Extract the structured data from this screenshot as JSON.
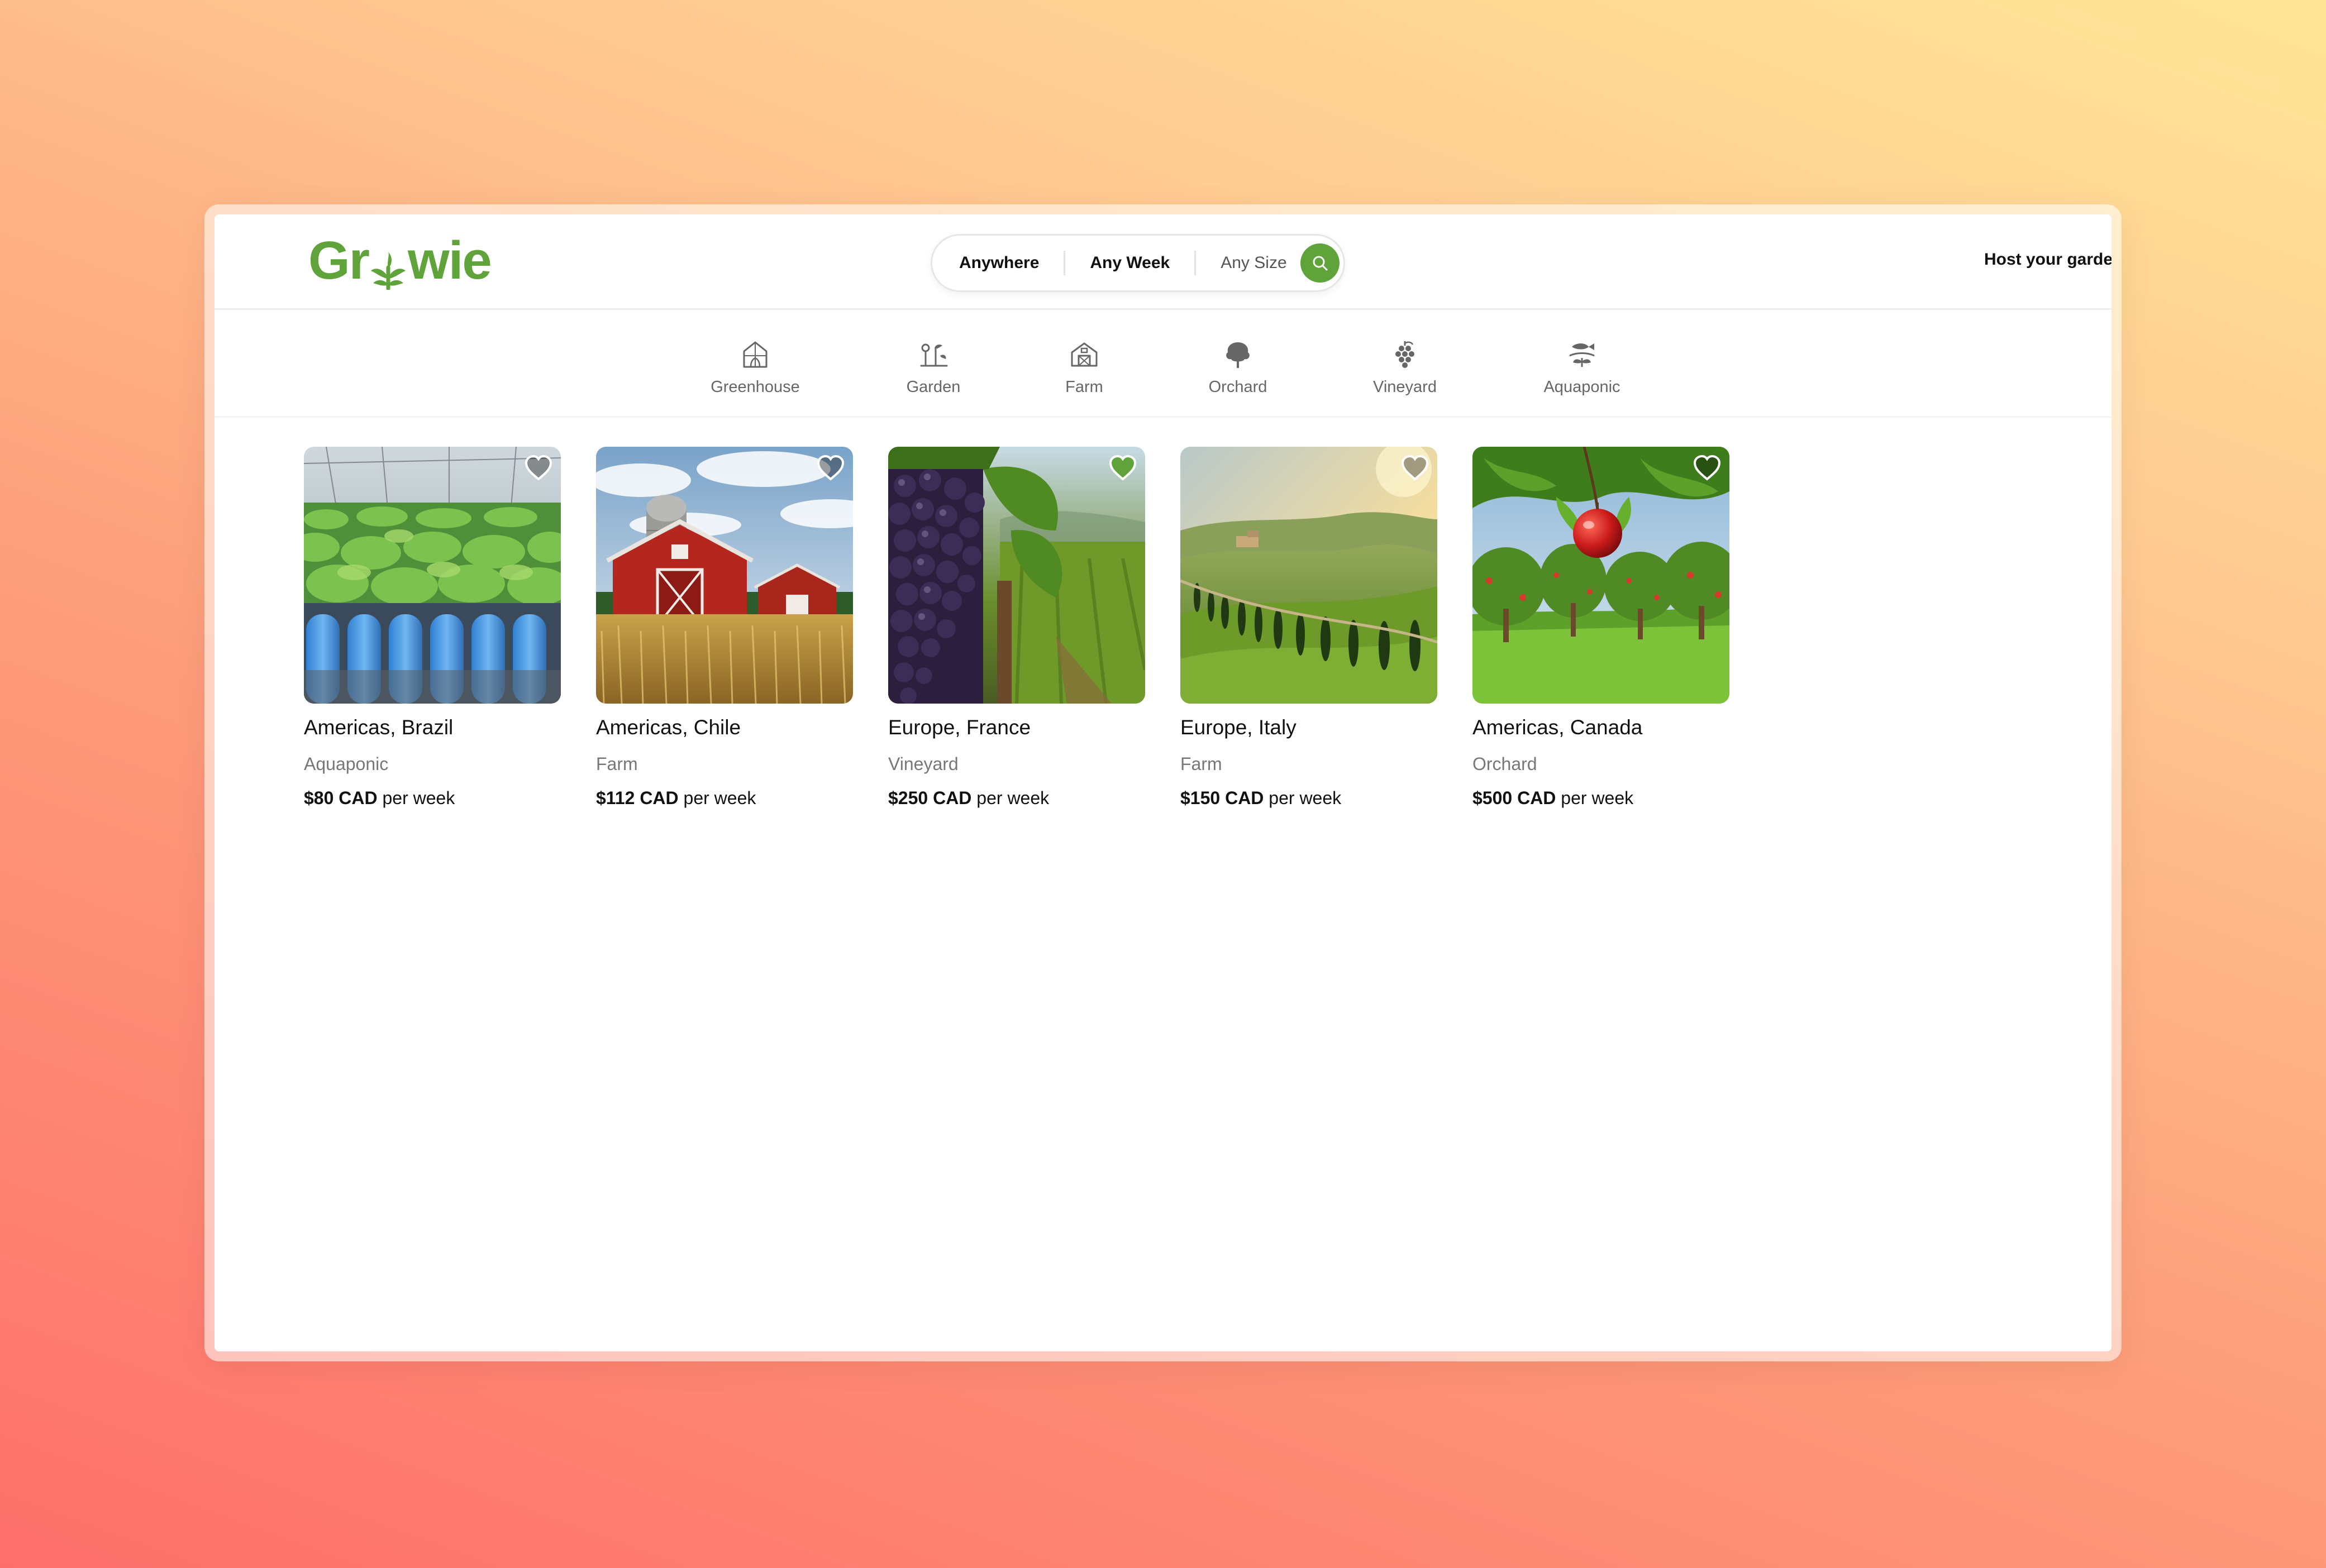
{
  "brand": {
    "logo_left": "Gr",
    "logo_right": "wie",
    "accent": "#5fa33a"
  },
  "search": {
    "where": "Anywhere",
    "when": "Any Week",
    "size_placeholder": "Any Size"
  },
  "header": {
    "host_label": "Host your garden"
  },
  "categories": [
    {
      "label": "Greenhouse",
      "icon": "greenhouse-icon"
    },
    {
      "label": "Garden",
      "icon": "garden-icon"
    },
    {
      "label": "Farm",
      "icon": "farm-barn-icon"
    },
    {
      "label": "Orchard",
      "icon": "tree-icon"
    },
    {
      "label": "Vineyard",
      "icon": "grapes-icon"
    },
    {
      "label": "Aquaponic",
      "icon": "fish-plant-icon"
    }
  ],
  "listings": [
    {
      "location": "Americas, Brazil",
      "type": "Aquaponic",
      "price": "$80 CAD",
      "per": "per week",
      "favorited": false
    },
    {
      "location": "Americas, Chile",
      "type": "Farm",
      "price": "$112 CAD",
      "per": "per week",
      "favorited": false
    },
    {
      "location": "Europe, France",
      "type": "Vineyard",
      "price": "$250 CAD",
      "per": "per week",
      "favorited": true
    },
    {
      "location": "Europe, Italy",
      "type": "Farm",
      "price": "$150 CAD",
      "per": "per week",
      "favorited": false
    },
    {
      "location": "Americas, Canada",
      "type": "Orchard",
      "price": "$500 CAD",
      "per": "per week",
      "favorited": false
    }
  ]
}
